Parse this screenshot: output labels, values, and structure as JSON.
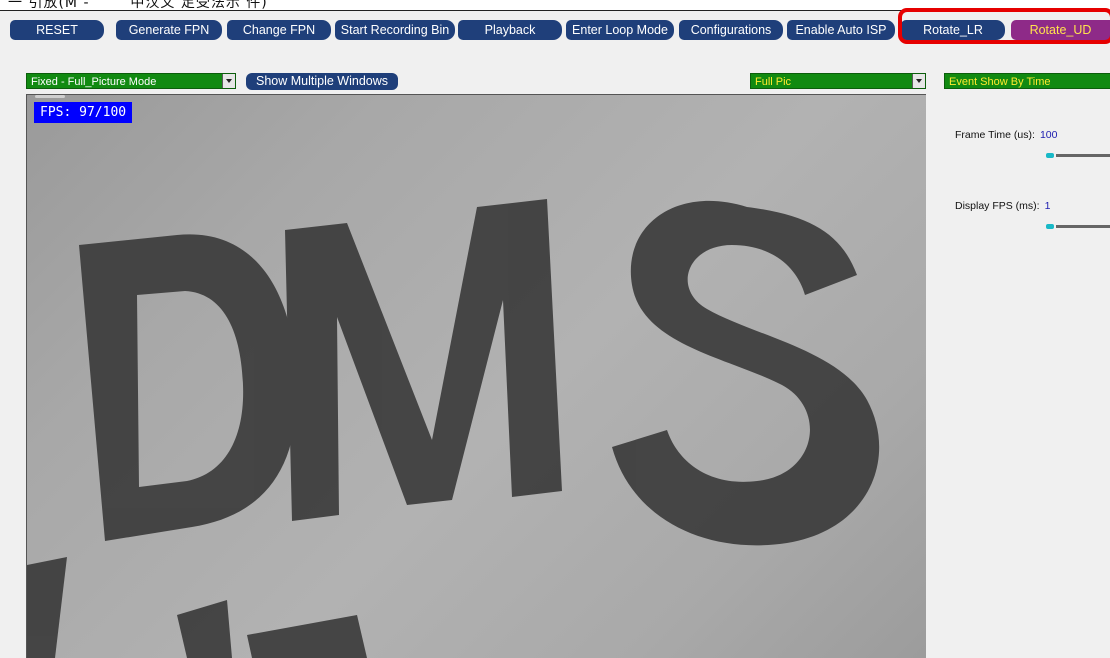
{
  "window": {
    "title_fragment": "一 引放(M - 　　 中汉文 足受法示 件)"
  },
  "toolbar": {
    "buttons": [
      {
        "label": "RESET",
        "active": false
      },
      {
        "label": "Generate FPN",
        "active": false
      },
      {
        "label": "Change FPN",
        "active": false
      },
      {
        "label": "Start Recording Bin",
        "active": false
      },
      {
        "label": "Playback",
        "active": false
      },
      {
        "label": "Enter Loop Mode",
        "active": false
      },
      {
        "label": "Configurations",
        "active": false
      },
      {
        "label": "Enable Auto ISP",
        "active": false
      },
      {
        "label": "Rotate_LR",
        "active": false
      },
      {
        "label": "Rotate_UD",
        "active": true
      }
    ]
  },
  "controls": {
    "mode_select": "Fixed - Full_Picture Mode",
    "show_multiple_windows": "Show Multiple Windows",
    "view_select": "Full Pic",
    "event_select": "Event Show By Time"
  },
  "video": {
    "fps_overlay": "FPS: 97/100",
    "scene_text": "DMS"
  },
  "right_panel": {
    "frame_time": {
      "label": "Frame Time (us):",
      "value": "100",
      "level": 0
    },
    "display_fps": {
      "label": "Display FPS (ms):",
      "value": "1",
      "level": 0
    }
  },
  "colors": {
    "button_bg": "#1f3f7a",
    "button_active_bg": "#8e2a88",
    "button_active_text": "#ffe34d",
    "dropdown_bg": "#118a11",
    "highlight_border": "#e60000",
    "fps_bg": "#0000ff",
    "value_text": "#2020b0"
  }
}
